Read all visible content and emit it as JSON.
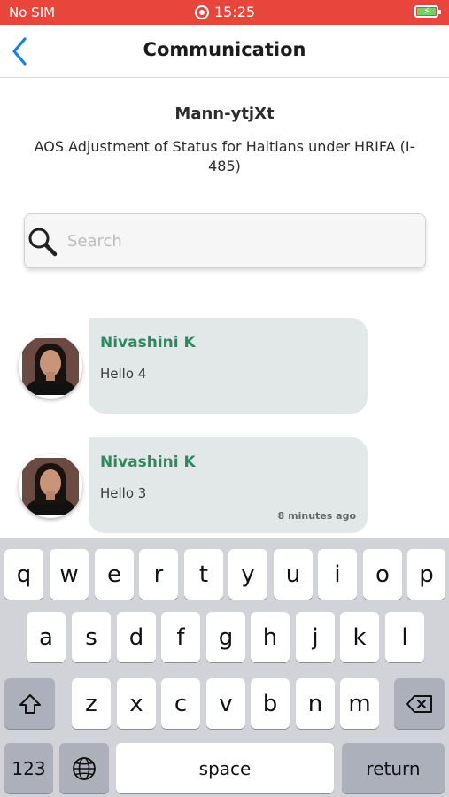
{
  "status_bar": {
    "carrier": "No SIM",
    "time": "15:25",
    "recording_icon": "record-icon",
    "battery_icon": "battery-charging-icon"
  },
  "header": {
    "back_icon": "chevron-left-icon",
    "title": "Communication"
  },
  "case": {
    "name": "Mann-ytjXt",
    "description": "AOS Adjustment of Status for Haitians under HRIFA (I-485)"
  },
  "search": {
    "placeholder": "Search",
    "value": "",
    "icon": "search-icon"
  },
  "messages": [
    {
      "sender": "Nivashini K",
      "text": "Hello 4",
      "time": ""
    },
    {
      "sender": "Nivashini K",
      "text": "Hello 3",
      "time": "8 minutes ago"
    }
  ],
  "keyboard": {
    "row1": [
      "q",
      "w",
      "e",
      "r",
      "t",
      "y",
      "u",
      "i",
      "o",
      "p"
    ],
    "row2": [
      "a",
      "s",
      "d",
      "f",
      "g",
      "h",
      "j",
      "k",
      "l"
    ],
    "row3": [
      "z",
      "x",
      "c",
      "v",
      "b",
      "n",
      "m"
    ],
    "shift_icon": "shift-icon",
    "delete_icon": "backspace-icon",
    "numbers_label": "123",
    "globe_icon": "globe-icon",
    "space_label": "space",
    "return_label": "return"
  },
  "colors": {
    "status_bar": "#e8453c",
    "accent": "#1a7ee6",
    "sender_name": "#2d8a5e",
    "bubble": "#e2e8e8"
  }
}
